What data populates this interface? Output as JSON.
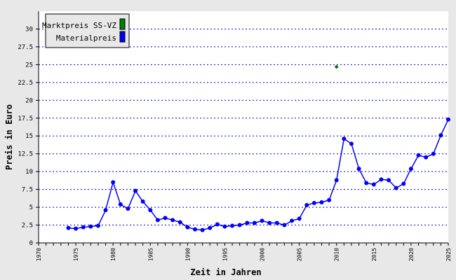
{
  "chart_data": {
    "type": "line",
    "title": "",
    "xlabel": "Zeit in Jahren",
    "ylabel": "Preis in Euro",
    "xlim": [
      1970,
      2025
    ],
    "ylim": [
      0,
      32.5
    ],
    "x_ticks": [
      1970,
      1975,
      1980,
      1985,
      1990,
      1995,
      2000,
      2005,
      2010,
      2015,
      2020,
      2025
    ],
    "y_ticks": [
      0,
      2.5,
      5,
      7.5,
      10,
      12.5,
      15,
      17.5,
      20,
      22.5,
      25,
      27.5,
      30
    ],
    "grid": "horizontal dotted",
    "legend_position": "top-left",
    "series": [
      {
        "name": "Marktpreis SS-VZ",
        "color": "#008000",
        "marker": "diamond",
        "line": false,
        "points": [
          [
            2010,
            24.7
          ]
        ]
      },
      {
        "name": "Materialpreis",
        "color": "#0000ff",
        "marker": "circle",
        "line": true,
        "points": [
          [
            1974,
            2.1
          ],
          [
            1975,
            2.0
          ],
          [
            1976,
            2.2
          ],
          [
            1977,
            2.3
          ],
          [
            1978,
            2.4
          ],
          [
            1979,
            4.6
          ],
          [
            1980,
            8.5
          ],
          [
            1981,
            5.4
          ],
          [
            1982,
            4.8
          ],
          [
            1983,
            7.3
          ],
          [
            1984,
            5.8
          ],
          [
            1985,
            4.6
          ],
          [
            1986,
            3.2
          ],
          [
            1987,
            3.5
          ],
          [
            1988,
            3.2
          ],
          [
            1989,
            2.9
          ],
          [
            1990,
            2.2
          ],
          [
            1991,
            1.9
          ],
          [
            1992,
            1.8
          ],
          [
            1993,
            2.1
          ],
          [
            1994,
            2.6
          ],
          [
            1995,
            2.3
          ],
          [
            1996,
            2.4
          ],
          [
            1997,
            2.5
          ],
          [
            1998,
            2.8
          ],
          [
            1999,
            2.8
          ],
          [
            2000,
            3.1
          ],
          [
            2001,
            2.8
          ],
          [
            2002,
            2.8
          ],
          [
            2003,
            2.5
          ],
          [
            2004,
            3.1
          ],
          [
            2005,
            3.4
          ],
          [
            2006,
            5.3
          ],
          [
            2007,
            5.6
          ],
          [
            2008,
            5.7
          ],
          [
            2009,
            6.0
          ],
          [
            2010,
            8.8
          ],
          [
            2011,
            14.6
          ],
          [
            2012,
            13.9
          ],
          [
            2013,
            10.4
          ],
          [
            2014,
            8.4
          ],
          [
            2015,
            8.2
          ],
          [
            2016,
            8.9
          ],
          [
            2017,
            8.8
          ],
          [
            2018,
            7.7
          ],
          [
            2019,
            8.3
          ],
          [
            2020,
            10.4
          ],
          [
            2021,
            12.3
          ],
          [
            2022,
            12.0
          ],
          [
            2023,
            12.5
          ],
          [
            2024,
            15.1
          ],
          [
            2025,
            17.3
          ]
        ]
      }
    ]
  }
}
